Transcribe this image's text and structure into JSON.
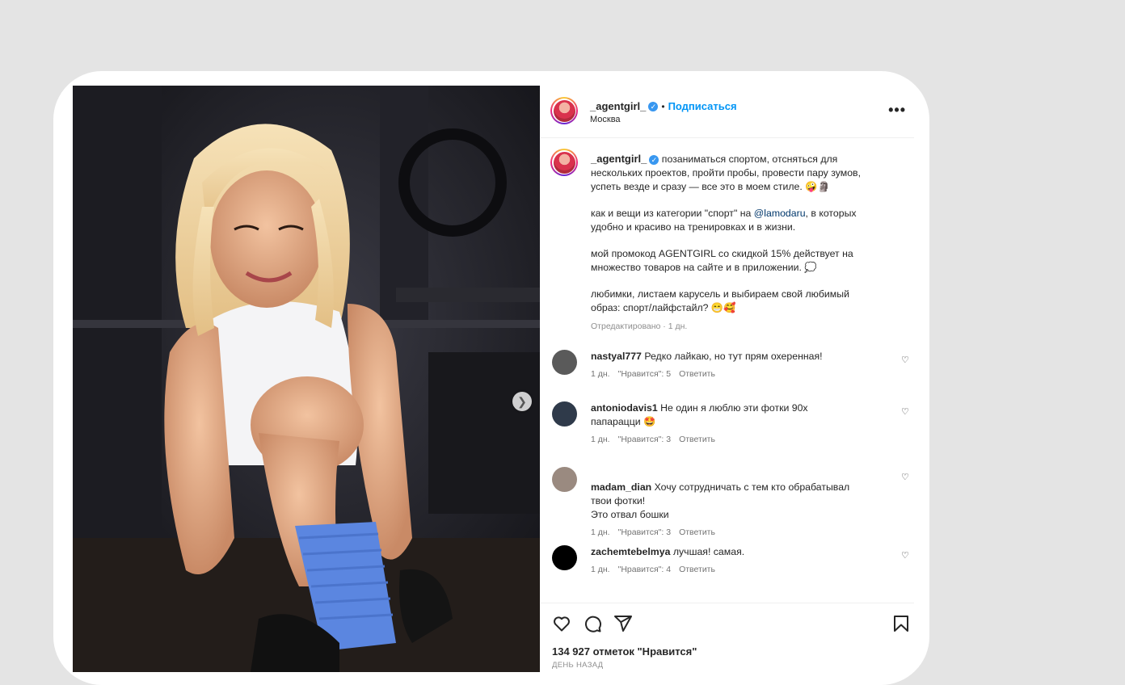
{
  "post": {
    "username": "_agentgirl_",
    "follow_label": "Подписаться",
    "location": "Москва",
    "more_label": "•••",
    "caption": {
      "para1": "позаниматься спортом, отсняться для нескольких проектов, пройти пробы, провести пару зумов, успеть везде и сразу — все это в моем стиле. 🤪🗿",
      "para2_pre": "как и вещи из категории \"спорт\" на ",
      "para2_mention": "@lamodaru",
      "para2_post": ", в которых удобно и красиво на тренировках и в жизни.",
      "para3": "мой промокод AGENTGIRL со скидкой 15% действует на множество товаров на сайте и в приложении. 💭",
      "para4": "любимки, листаем карусель и выбираем свой любимый образ: спорт/лайфстайл? 😁🥰",
      "edited": "Отредактировано · 1 дн."
    },
    "comments": [
      {
        "user": "nastyal777",
        "text": "Редко лайкаю, но тут прям охеренная!",
        "time": "1 дн.",
        "likes": "\"Нравится\": 5",
        "reply": "Ответить",
        "avatar_color": "#5a5a5a"
      },
      {
        "user": "antoniodavis1",
        "text": "Не один я люблю эти фотки 90х папарацци 🤩",
        "time": "1 дн.",
        "likes": "\"Нравится\": 3",
        "reply": "Ответить",
        "avatar_color": "#2f3a4a"
      },
      {
        "user": "madam_dian",
        "text": "Хочу сотрудничать с тем кто обрабатывал твои фотки!\nЭто отвал бошки",
        "time": "1 дн.",
        "likes": "\"Нравится\": 3",
        "reply": "Ответить",
        "avatar_color": "#9a8a80"
      },
      {
        "user": "zachemtebelmya",
        "text": "лучшая! самая.",
        "time": "1 дн.",
        "likes": "\"Нравится\": 4",
        "reply": "Ответить",
        "avatar_color": "#000000"
      }
    ],
    "likes_count": "134 927 отметок \"Нравится\"",
    "time_ago": "ДЕНЬ НАЗАД"
  },
  "colors": {
    "accent": "#0095f6",
    "verified": "#3897f0",
    "page_bg": "#e4e4e4"
  },
  "icons": [
    "heart-icon",
    "comment-icon",
    "share-icon",
    "bookmark-icon",
    "verified-icon",
    "chevron-right-icon"
  ]
}
